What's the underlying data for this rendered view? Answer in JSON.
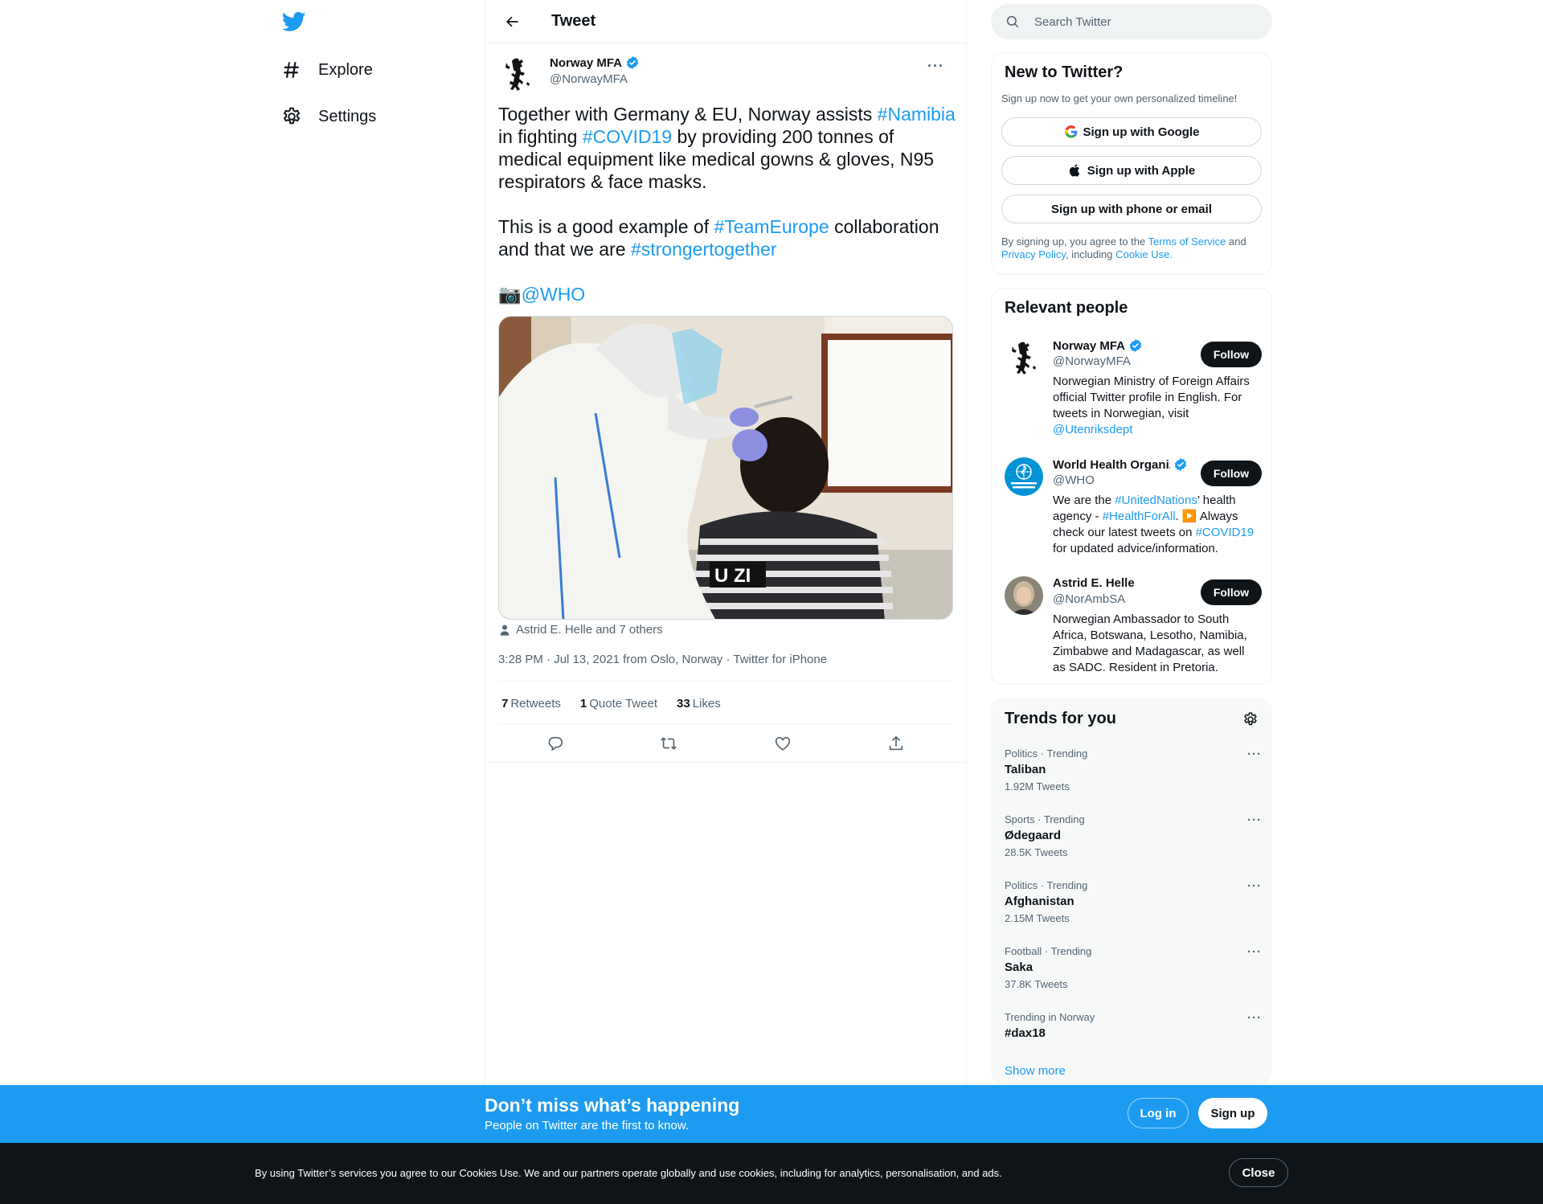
{
  "nav": {
    "items": [
      {
        "label": "Explore",
        "icon": "hashtag-icon"
      },
      {
        "label": "Settings",
        "icon": "gear-icon"
      }
    ]
  },
  "header": {
    "title": "Tweet"
  },
  "tweet": {
    "author_name": "Norway MFA",
    "author_handle": "@NorwayMFA",
    "text_p1": {
      "a": "Together with Germany & EU, Norway assists ",
      "tag1": "#Namibia",
      "b": " in fighting ",
      "tag2": "#COVID19",
      "c": " by providing 200 tonnes of medical equipment like medical gowns & gloves, N95 respirators & face masks."
    },
    "text_p2": {
      "a": "This is a good example of ",
      "tag1": "#TeamEurope",
      "b": " collaboration and that we are ",
      "tag2": "#strongertogether"
    },
    "text_p3": {
      "emoji": "📷",
      "mention": "@WHO"
    },
    "tagged_people": "Astrid E. Helle and 7 others",
    "time": "3:28 PM · Jul 13, 2021",
    "location": " from Oslo, Norway",
    "source": " · Twitter for iPhone",
    "stats": {
      "retweets_count": "7",
      "retweets_label": "Retweets",
      "quotes_count": "1",
      "quotes_label": "Quote Tweet",
      "likes_count": "33",
      "likes_label": "Likes"
    }
  },
  "search": {
    "placeholder": "Search Twitter"
  },
  "new_to_twitter": {
    "title": "New to Twitter?",
    "subtitle": "Sign up now to get your own personalized timeline!",
    "google": "Sign up with Google",
    "apple": "Sign up with Apple",
    "phone": "Sign up with phone or email",
    "legal_a": "By signing up, you agree to the ",
    "terms": "Terms of Service",
    "legal_b": " and ",
    "privacy": "Privacy Policy",
    "legal_c": ", including ",
    "cookie": "Cookie Use."
  },
  "relevant_people": {
    "title": "Relevant people",
    "follow_label": "Follow",
    "people": [
      {
        "name": "Norway MFA",
        "handle": "@NorwayMFA",
        "bio_a": "Norwegian Ministry of Foreign Affairs official Twitter profile in English. For tweets in Norwegian, visit ",
        "bio_link": "@Utenriksdept"
      },
      {
        "name": "World Health Organization (WHO)",
        "handle": "@WHO",
        "bio_a": "We are the ",
        "bio_l1": "#UnitedNations",
        "bio_b": "’ health agency - ",
        "bio_l2": "#HealthForAll",
        "bio_c": ". ▶️ Always check our latest tweets on ",
        "bio_l3": "#COVID19",
        "bio_d": " for updated advice/information."
      },
      {
        "name": "Astrid E. Helle",
        "handle": "@NorAmbSA",
        "bio_a": "Norwegian Ambassador to South Africa, Botswana, Lesotho, Namibia, Zimbabwe and Madagascar, as well as SADC. Resident in Pretoria."
      }
    ]
  },
  "trends": {
    "title": "Trends for you",
    "items": [
      {
        "category": "Politics · Trending",
        "name": "Taliban",
        "count": "1.92M Tweets"
      },
      {
        "category": "Sports · Trending",
        "name": "Ødegaard",
        "count": "28.5K Tweets"
      },
      {
        "category": "Politics · Trending",
        "name": "Afghanistan",
        "count": "2.15M Tweets"
      },
      {
        "category": "Football · Trending",
        "name": "Saka",
        "count": "37.8K Tweets"
      },
      {
        "category": "Trending in Norway",
        "name": "#dax18",
        "count": ""
      }
    ],
    "show_more": "Show more"
  },
  "bottom_bar": {
    "title": "Don’t miss what’s happening",
    "subtitle": "People on Twitter are the first to know.",
    "login": "Log in",
    "signup": "Sign up"
  },
  "cookie_bar": {
    "text": "By using Twitter’s services you agree to our Cookies Use. We and our partners operate globally and use cookies, including for analytics, personalisation, and ads.",
    "close": "Close"
  },
  "colors": {
    "accent": "#1d9bf0",
    "text": "#0f1419",
    "muted": "#536471",
    "dark_button": "#0f1419",
    "who_blue": "#0093d5"
  }
}
